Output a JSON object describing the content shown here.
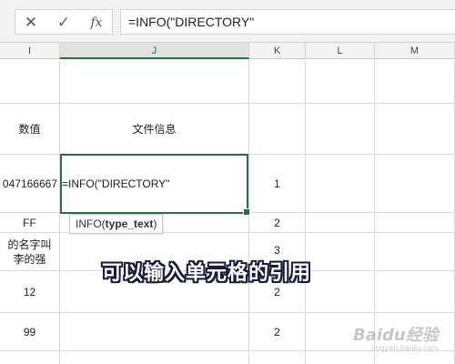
{
  "formula_bar": {
    "cancel_icon": "close-icon",
    "confirm_icon": "check-icon",
    "fx_label": "fx",
    "formula": "=INFO(\"DIRECTORY\""
  },
  "columns": [
    {
      "label": "I"
    },
    {
      "label": "J"
    },
    {
      "label": "K"
    },
    {
      "label": "L"
    },
    {
      "label": "M"
    }
  ],
  "rows": [
    {
      "i": "",
      "j": "",
      "k": ""
    },
    {
      "i": "数值",
      "j": "文件信息",
      "k": ""
    },
    {
      "i": "047166667",
      "j": "=INFO(\"DIRECTORY\"",
      "k": "1"
    },
    {
      "i": "FF",
      "j": "",
      "k": "2"
    },
    {
      "i": "的名字叫\n李的强",
      "j": "",
      "k": "3"
    },
    {
      "i": "12",
      "j": "",
      "k": "2"
    },
    {
      "i": "99",
      "j": "",
      "k": "2"
    }
  ],
  "tooltip": {
    "func": "INFO(",
    "arg": "type_text",
    "close": ")"
  },
  "caption": "可以输入单元格的引用",
  "watermark": {
    "brand": "Baidu经验",
    "url": "jingyan.baidu.com"
  },
  "colors": {
    "accent": "#217346",
    "grid": "#dadada",
    "header_bg": "#f3f3f3"
  }
}
